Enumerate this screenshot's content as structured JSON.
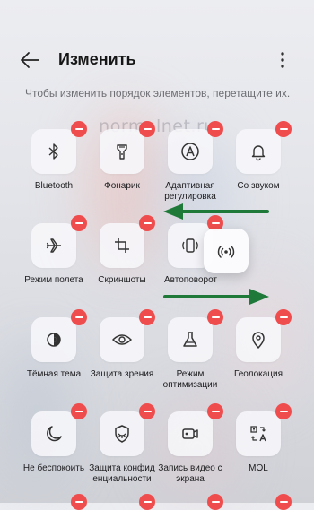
{
  "header": {
    "title": "Изменить",
    "hint": "Чтобы изменить порядок элементов, перетащите их."
  },
  "watermark": "normalnet.ru",
  "tiles": [
    {
      "label": "Bluetooth",
      "icon": "bluetooth-icon"
    },
    {
      "label": "Фонарик",
      "icon": "flashlight-icon"
    },
    {
      "label": "Адаптивная регулировка",
      "icon": "auto-brightness-icon"
    },
    {
      "label": "Со звуком",
      "icon": "bell-icon"
    },
    {
      "label": "Режим полета",
      "icon": "airplane-icon"
    },
    {
      "label": "Скриншоты",
      "icon": "crop-icon"
    },
    {
      "label": "Автоповорот",
      "icon": "auto-rotate-icon"
    },
    {
      "label": "Тёмная тема",
      "icon": "dark-theme-icon"
    },
    {
      "label": "Защита зрения",
      "icon": "eye-icon"
    },
    {
      "label": "Режим оптимизации",
      "icon": "flask-icon"
    },
    {
      "label": "Геолокация",
      "icon": "location-pin-icon"
    },
    {
      "label": "Не беспокоить",
      "icon": "moon-icon"
    },
    {
      "label": "Защита конфид енциальности",
      "icon": "privacy-icon"
    },
    {
      "label": "Запись видео с экрана",
      "icon": "screen-record-icon"
    },
    {
      "label": "MOL",
      "icon": "translate-icon"
    }
  ],
  "drag_tile": {
    "icon": "hotspot-icon"
  },
  "annotations": {
    "arrow_color": "#1f7a3a"
  }
}
